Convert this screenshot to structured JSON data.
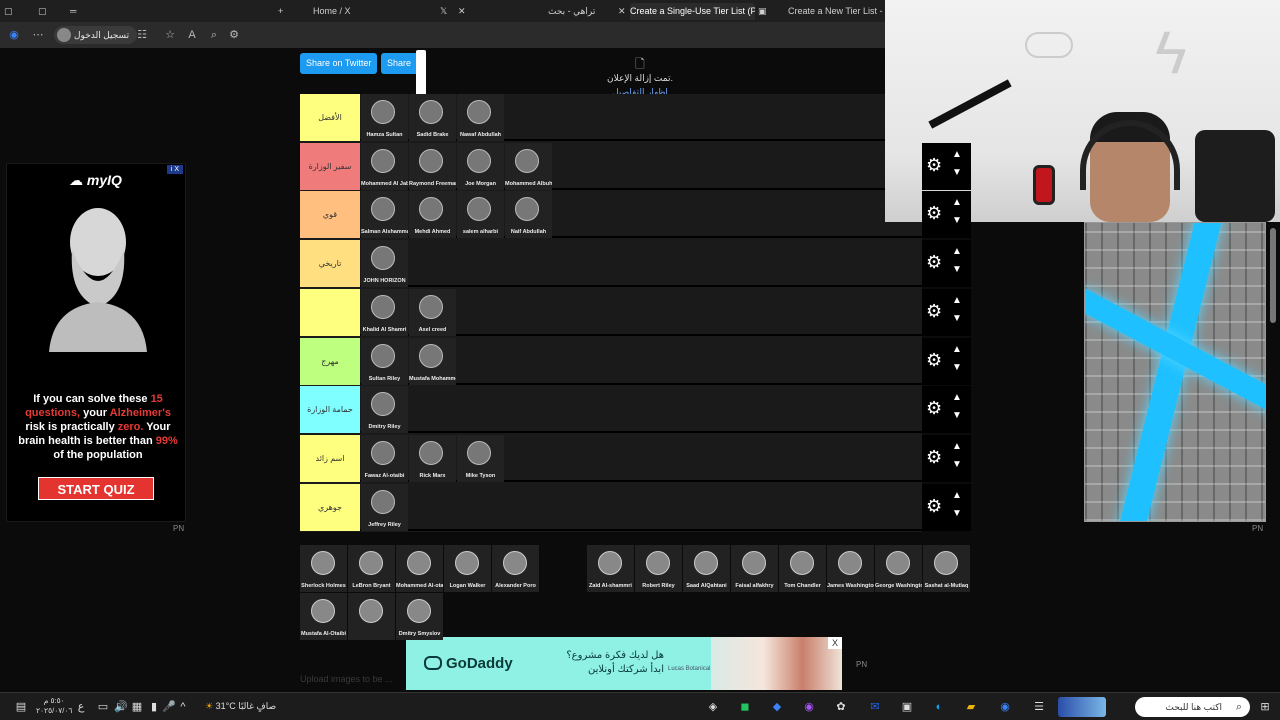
{
  "browser": {
    "tabs": [
      {
        "label": "Home / X"
      },
      {
        "label": "تراهي - بحث"
      },
      {
        "label": "Create a Single-Use Tier List (Priv"
      },
      {
        "label": "Create a New Tier List - Tie"
      }
    ],
    "profile_label": "تسجيل الدخول"
  },
  "share": {
    "twitter": "Share on Twitter",
    "other": "Share o"
  },
  "ad_removed": {
    "line1": "تمت إزالة الإعلان.",
    "link": "إظهار التفاصيل"
  },
  "pn": "PN",
  "ad_left": {
    "brand": "myIQ",
    "copy_1": "If you can solve these ",
    "copy_2": "15 questions,",
    "copy_3": " your ",
    "copy_4": "Alzheimer's",
    "copy_5": " risk is practically ",
    "copy_6": "zero.",
    "copy_7": " Your brain health is better than ",
    "copy_8": "99%",
    "copy_9": " of the population",
    "button": "START QUIZ",
    "close": "i X"
  },
  "tiers": [
    {
      "label": "الأفضل",
      "color": "#ffff7f",
      "cards": [
        "Hamza Sultan",
        "Sadid Brake",
        "Nawaf Abdullah"
      ]
    },
    {
      "label": "سفير الوزارة",
      "color": "#f07b7b",
      "cards": [
        "Mohammed Al Jabri",
        "Raymond Freeman",
        "Joe Morgan",
        "Mohammed Albuhaidi"
      ]
    },
    {
      "label": "قوي",
      "color": "#ffbf7f",
      "cards": [
        "Salman Alshammari",
        "Mehdi Ahmed",
        "salem alharbi",
        "Naif Abdullah"
      ]
    },
    {
      "label": "تاريخي",
      "color": "#ffdf7f",
      "cards": [
        "JOHN HORIZON"
      ]
    },
    {
      "label": "",
      "color": "#ffff7f",
      "cards": [
        "Khalid Al Shamri",
        "Axel creed"
      ]
    },
    {
      "label": "مهرج",
      "color": "#bfff7f",
      "cards": [
        "Sultan Riley",
        "Mustafa Mohammed"
      ]
    },
    {
      "label": "حمامة الوزارة",
      "color": "#7fffff",
      "cards": [
        "Dmitry Riley"
      ]
    },
    {
      "label": "اسم زائد",
      "color": "#ffff7f",
      "cards": [
        "Fawaz Al-otaibi",
        "Rick Marx",
        "Mike Tyson"
      ]
    },
    {
      "label": "جوهري",
      "color": "#ffff7f",
      "cards": [
        "Jeffrey Riley"
      ]
    }
  ],
  "pool_left": [
    "Sherlock Holmes",
    "LeBron Bryant",
    "Mohammed Al-otaibi",
    "Logan Walker",
    "Alexander Poro",
    "Mustafa Al-Otaibi",
    "",
    "Dmitry Smyslov"
  ],
  "pool_right": [
    "Zaid Al-shammri",
    "Robert Riley",
    "Saad AlQahtani",
    "Faisal alfakhry",
    "Tom Chandler",
    "James Washington",
    "George Washington",
    "Sashat al-Mutlaq"
  ],
  "upload_note": "Upload images to be ...",
  "ad_bottom": {
    "brand": "GoDaddy",
    "headline": "هل لديك فكرة مشروع؟ ابدأ شركتك أونلاين",
    "small": "Lucas Botanical GODADDY.COM",
    "close": "X"
  },
  "taskbar": {
    "time": "٥:٥٠ م",
    "date": "٢٠٢٥/٠٧/٠٦",
    "weather": "31°C صافٍ غالبًا",
    "search_placeholder": "اكتب هنا للبحث"
  }
}
